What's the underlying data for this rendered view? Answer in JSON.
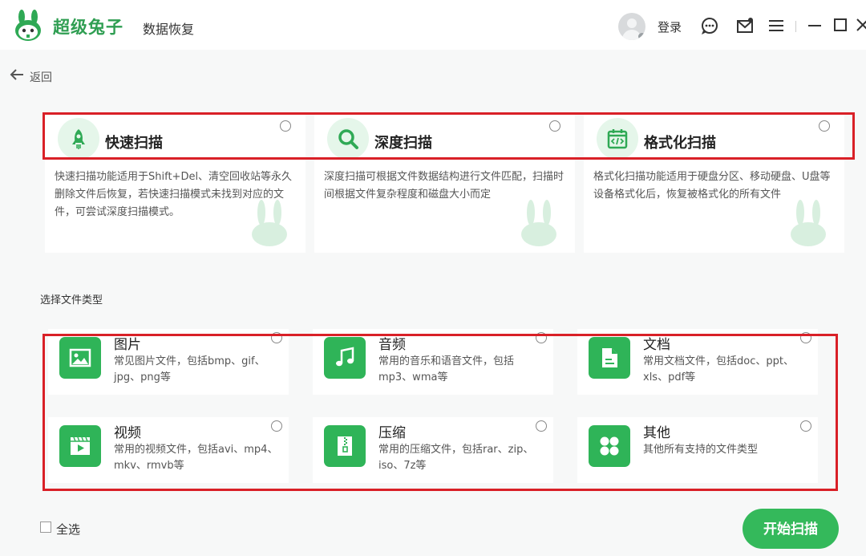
{
  "app": {
    "brand": "超级兔子",
    "subtitle": "数据恢复"
  },
  "header": {
    "login_label": "登录"
  },
  "nav": {
    "back_label": "返回"
  },
  "scan_modes": [
    {
      "title": "快速扫描",
      "icon": "rocket-icon",
      "description": "快速扫描功能适用于Shift+Del、清空回收站等永久删除文件后恢复，若快速扫描模式未找到对应的文件，可尝试深度扫描模式。"
    },
    {
      "title": "深度扫描",
      "icon": "magnifier-icon",
      "description": "深度扫描可根据文件数据结构进行文件匹配，扫描时间根据文件复杂程度和磁盘大小而定"
    },
    {
      "title": "格式化扫描",
      "icon": "calendar-code-icon",
      "description": "格式化扫描功能适用于硬盘分区、移动硬盘、U盘等设备格式化后，恢复被格式化的所有文件"
    }
  ],
  "file_types": {
    "label": "选择文件类型",
    "items": [
      {
        "title": "图片",
        "icon": "image-icon",
        "description": "常见图片文件，包括bmp、gif、jpg、png等"
      },
      {
        "title": "音频",
        "icon": "music-icon",
        "description": "常用的音乐和语音文件，包括mp3、wma等"
      },
      {
        "title": "文档",
        "icon": "document-icon",
        "description": "常用文档文件，包括doc、ppt、xls、pdf等"
      },
      {
        "title": "视频",
        "icon": "video-icon",
        "description": "常用的视频文件，包括avi、mp4、mkv、rmvb等"
      },
      {
        "title": "压缩",
        "icon": "archive-icon",
        "description": "常用的压缩文件，包括rar、zip、iso、7z等"
      },
      {
        "title": "其他",
        "icon": "grid-icon",
        "description": "其他所有支持的文件类型"
      }
    ]
  },
  "footer": {
    "select_all_label": "全选",
    "start_label": "开始扫描"
  },
  "colors": {
    "accent": "#34b95b",
    "highlight_border": "#d92027",
    "icon_bg": "#2fb458"
  }
}
